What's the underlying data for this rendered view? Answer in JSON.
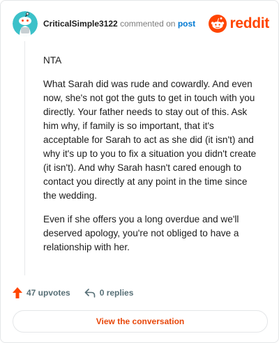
{
  "header": {
    "username": "CriticalSimple3122",
    "action_text": "commented on",
    "post_link": "post",
    "brand": "reddit"
  },
  "comment": {
    "paragraphs": [
      "NTA",
      "What Sarah did was rude and cowardly. And even now, she's not got the guts to get in touch with you directly. Your father needs to stay out of this. Ask him why, if family is so important, that it's acceptable for Sarah to act as she did (it isn't) and why it's up to you to fix a situation you didn't create (it isn't). And why Sarah hasn't cared enough to contact you directly at any point in the time since the wedding.",
      "Even if she offers you a long overdue and we'll deserved apology, you're not obliged to have a relationship with her."
    ]
  },
  "actions": {
    "upvotes": "47 upvotes",
    "replies": "0 replies"
  },
  "cta": {
    "label": "View the conversation"
  },
  "colors": {
    "brand": "#ff4500",
    "link": "#0079d3",
    "avatar": "#3cc1c9"
  }
}
